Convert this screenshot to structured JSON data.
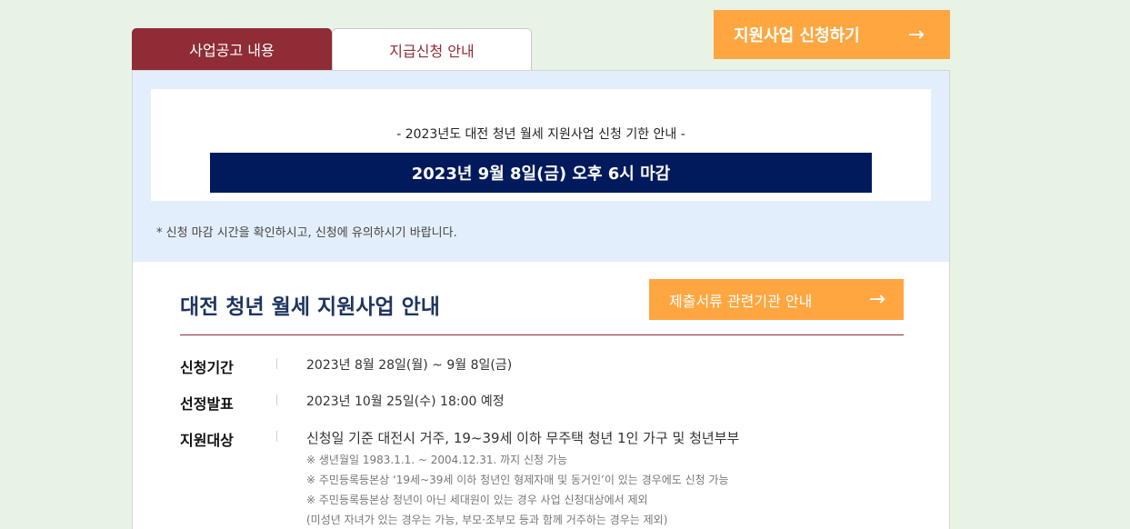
{
  "tabs": [
    {
      "label": "사업공고 내용",
      "active": true
    },
    {
      "label": "지급신청 안내",
      "active": false
    }
  ],
  "apply_button": {
    "label": "지원사업 신청하기",
    "arrow": "→"
  },
  "notice": {
    "title": "- 2023년도 대전 청년 월세 지원사업 신청 기한 안내 -",
    "deadline": "2023년 9월 8일(금) 오후 6시 마감",
    "caution": "* 신청 마감 시간을 확인하시고, 신청에 유의하시기 바랍니다."
  },
  "section": {
    "title": "대전 청년 월세 지원사업 안내",
    "docs_button": {
      "label": "제출서류 관련기관 안내",
      "arrow": "→"
    }
  },
  "info_rows": [
    {
      "label": "신청기간",
      "value": "2023년 8월 28일(월) ~ 9월 8일(금)"
    },
    {
      "label": "선정발표",
      "value": "2023년 10월 25일(수) 18:00 예정"
    },
    {
      "label": "지원대상",
      "value": "신청일 기준 대전시 거주, 19~39세 이하 무주택 청년 1인 가구 및 청년부부",
      "notes": [
        "※ 생년월일 1983.1.1. ~ 2004.12.31. 까지 신청 가능",
        "※ 주민등록등본상 ‘19세~39세 이하 청년인 형제자매 및 동거인’이 있는 경우에도 신청 가능",
        "※ 주민등록등본상 청년이 아닌 세대원이 있는 경우 사업 신청대상에서 제외",
        "(미성년 자녀가 있는 경우는 가능, 부모·조부모 등과 함께 거주하는 경우는 제외)"
      ]
    }
  ],
  "colors": {
    "accent": "#8f2c35",
    "orange": "#ffa640",
    "navy": "#001a5c",
    "background": "#e8f3e6"
  }
}
